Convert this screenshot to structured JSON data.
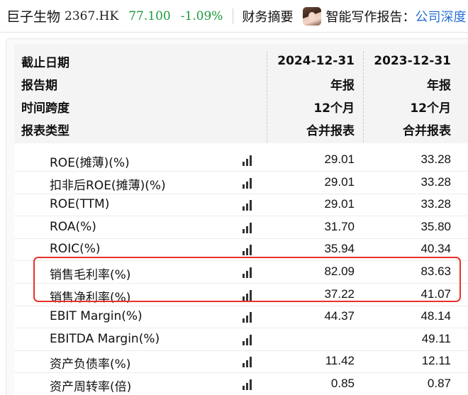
{
  "header": {
    "stock_name": "巨子生物",
    "stock_code": "2367.HK",
    "price": "77.100",
    "change_pct": "-1.09%",
    "tab_label": "财务摘要",
    "ai_label": "智能写作报告：",
    "ai_link": "公司深度",
    "colors": {
      "down": "#1a9a3c",
      "link": "#2a6fd6",
      "highlight": "#e8322a"
    }
  },
  "table": {
    "meta_rows": [
      {
        "label": "截止日期",
        "col1": "2024-12-31",
        "col2": "2023-12-31"
      },
      {
        "label": "报告期",
        "col1": "年报",
        "col2": "年报"
      },
      {
        "label": "时间跨度",
        "col1": "12个月",
        "col2": "12个月"
      },
      {
        "label": "报表类型",
        "col1": "合并报表",
        "col2": "合并报表"
      }
    ],
    "rows": [
      {
        "name": "ROE(摊薄)(%)",
        "col1": "29.01",
        "col2": "33.28"
      },
      {
        "name": "扣非后ROE(摊薄)(%)",
        "col1": "29.01",
        "col2": "33.28"
      },
      {
        "name": "ROE(TTM)",
        "col1": "29.01",
        "col2": "33.28"
      },
      {
        "name": "ROA(%)",
        "col1": "31.70",
        "col2": "35.80"
      },
      {
        "name": "ROIC(%)",
        "col1": "35.94",
        "col2": "40.34"
      },
      {
        "name": "销售毛利率(%)",
        "col1": "82.09",
        "col2": "83.63"
      },
      {
        "name": "销售净利率(%)",
        "col1": "37.22",
        "col2": "41.07"
      },
      {
        "name": "EBIT Margin(%)",
        "col1": "44.37",
        "col2": "48.14"
      },
      {
        "name": "EBITDA Margin(%)",
        "col1": "",
        "col2": "49.11"
      },
      {
        "name": "资产负债率(%)",
        "col1": "11.42",
        "col2": "12.11"
      },
      {
        "name": "资产周转率(倍)",
        "col1": "0.85",
        "col2": "0.87"
      }
    ],
    "chart_icon": "bar-chart-icon"
  }
}
